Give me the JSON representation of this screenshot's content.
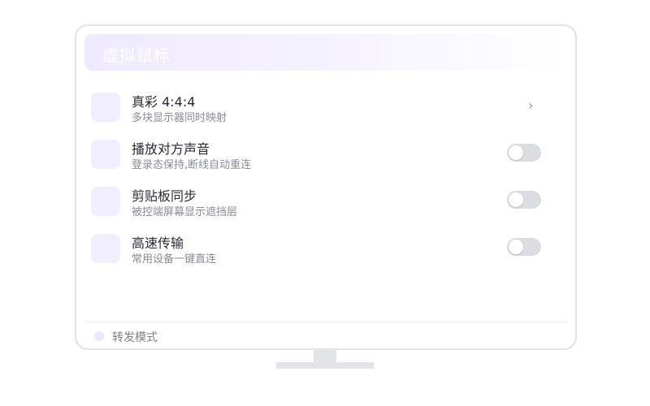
{
  "header": {
    "title": "虚拟鼠标"
  },
  "rows": [
    {
      "title": "真彩 4:4:4",
      "subtitle": "多块显示器同时映射",
      "control": "chevron",
      "chevron_glyph": "›"
    },
    {
      "title": "播放对方声音",
      "subtitle": "登录态保持,断线自动重连",
      "control": "toggle",
      "enabled": false
    },
    {
      "title": "剪贴板同步",
      "subtitle": "被控端屏幕显示遮挡层",
      "control": "toggle",
      "enabled": false
    },
    {
      "title": "高速传输",
      "subtitle": "常用设备一键直连",
      "control": "toggle",
      "enabled": false
    }
  ],
  "footer": {
    "label": "转发模式"
  },
  "colors": {
    "accent_tint": "#f1eefd",
    "toggle_off": "#dcdde2",
    "frame": "#e3e4e8"
  }
}
